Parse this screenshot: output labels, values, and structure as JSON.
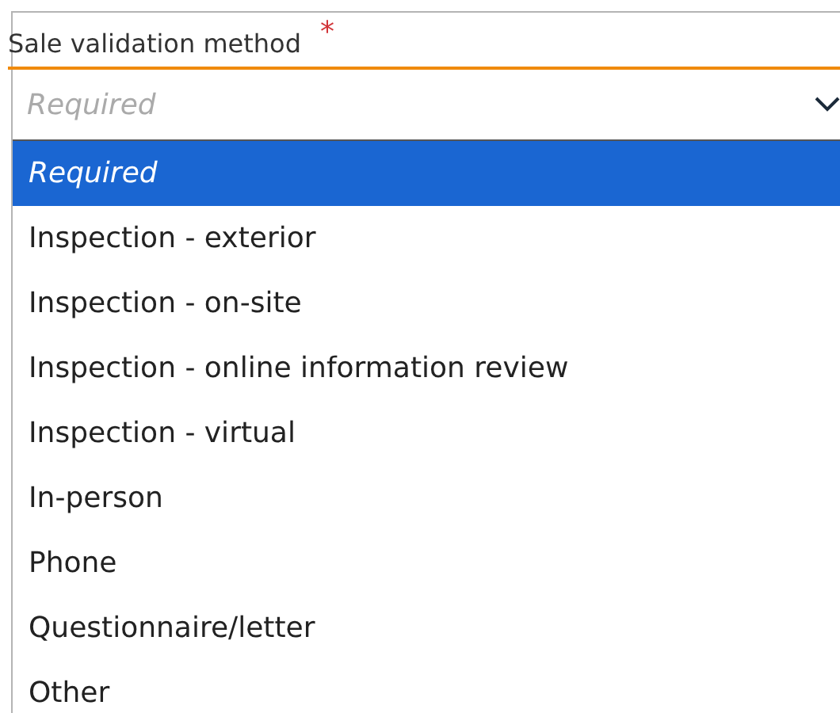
{
  "field": {
    "label": "Sale validation method",
    "required_mark": "*",
    "placeholder": "Required"
  },
  "options": [
    {
      "label": "Required",
      "kind": "placeholder",
      "selected": true
    },
    {
      "label": "Inspection - exterior",
      "kind": "option",
      "selected": false
    },
    {
      "label": "Inspection - on-site",
      "kind": "option",
      "selected": false
    },
    {
      "label": "Inspection - online information review",
      "kind": "option",
      "selected": false
    },
    {
      "label": "Inspection - virtual",
      "kind": "option",
      "selected": false
    },
    {
      "label": "In-person",
      "kind": "option",
      "selected": false
    },
    {
      "label": "Phone",
      "kind": "option",
      "selected": false
    },
    {
      "label": "Questionnaire/letter",
      "kind": "option",
      "selected": false
    },
    {
      "label": "Other",
      "kind": "option",
      "selected": false
    }
  ]
}
